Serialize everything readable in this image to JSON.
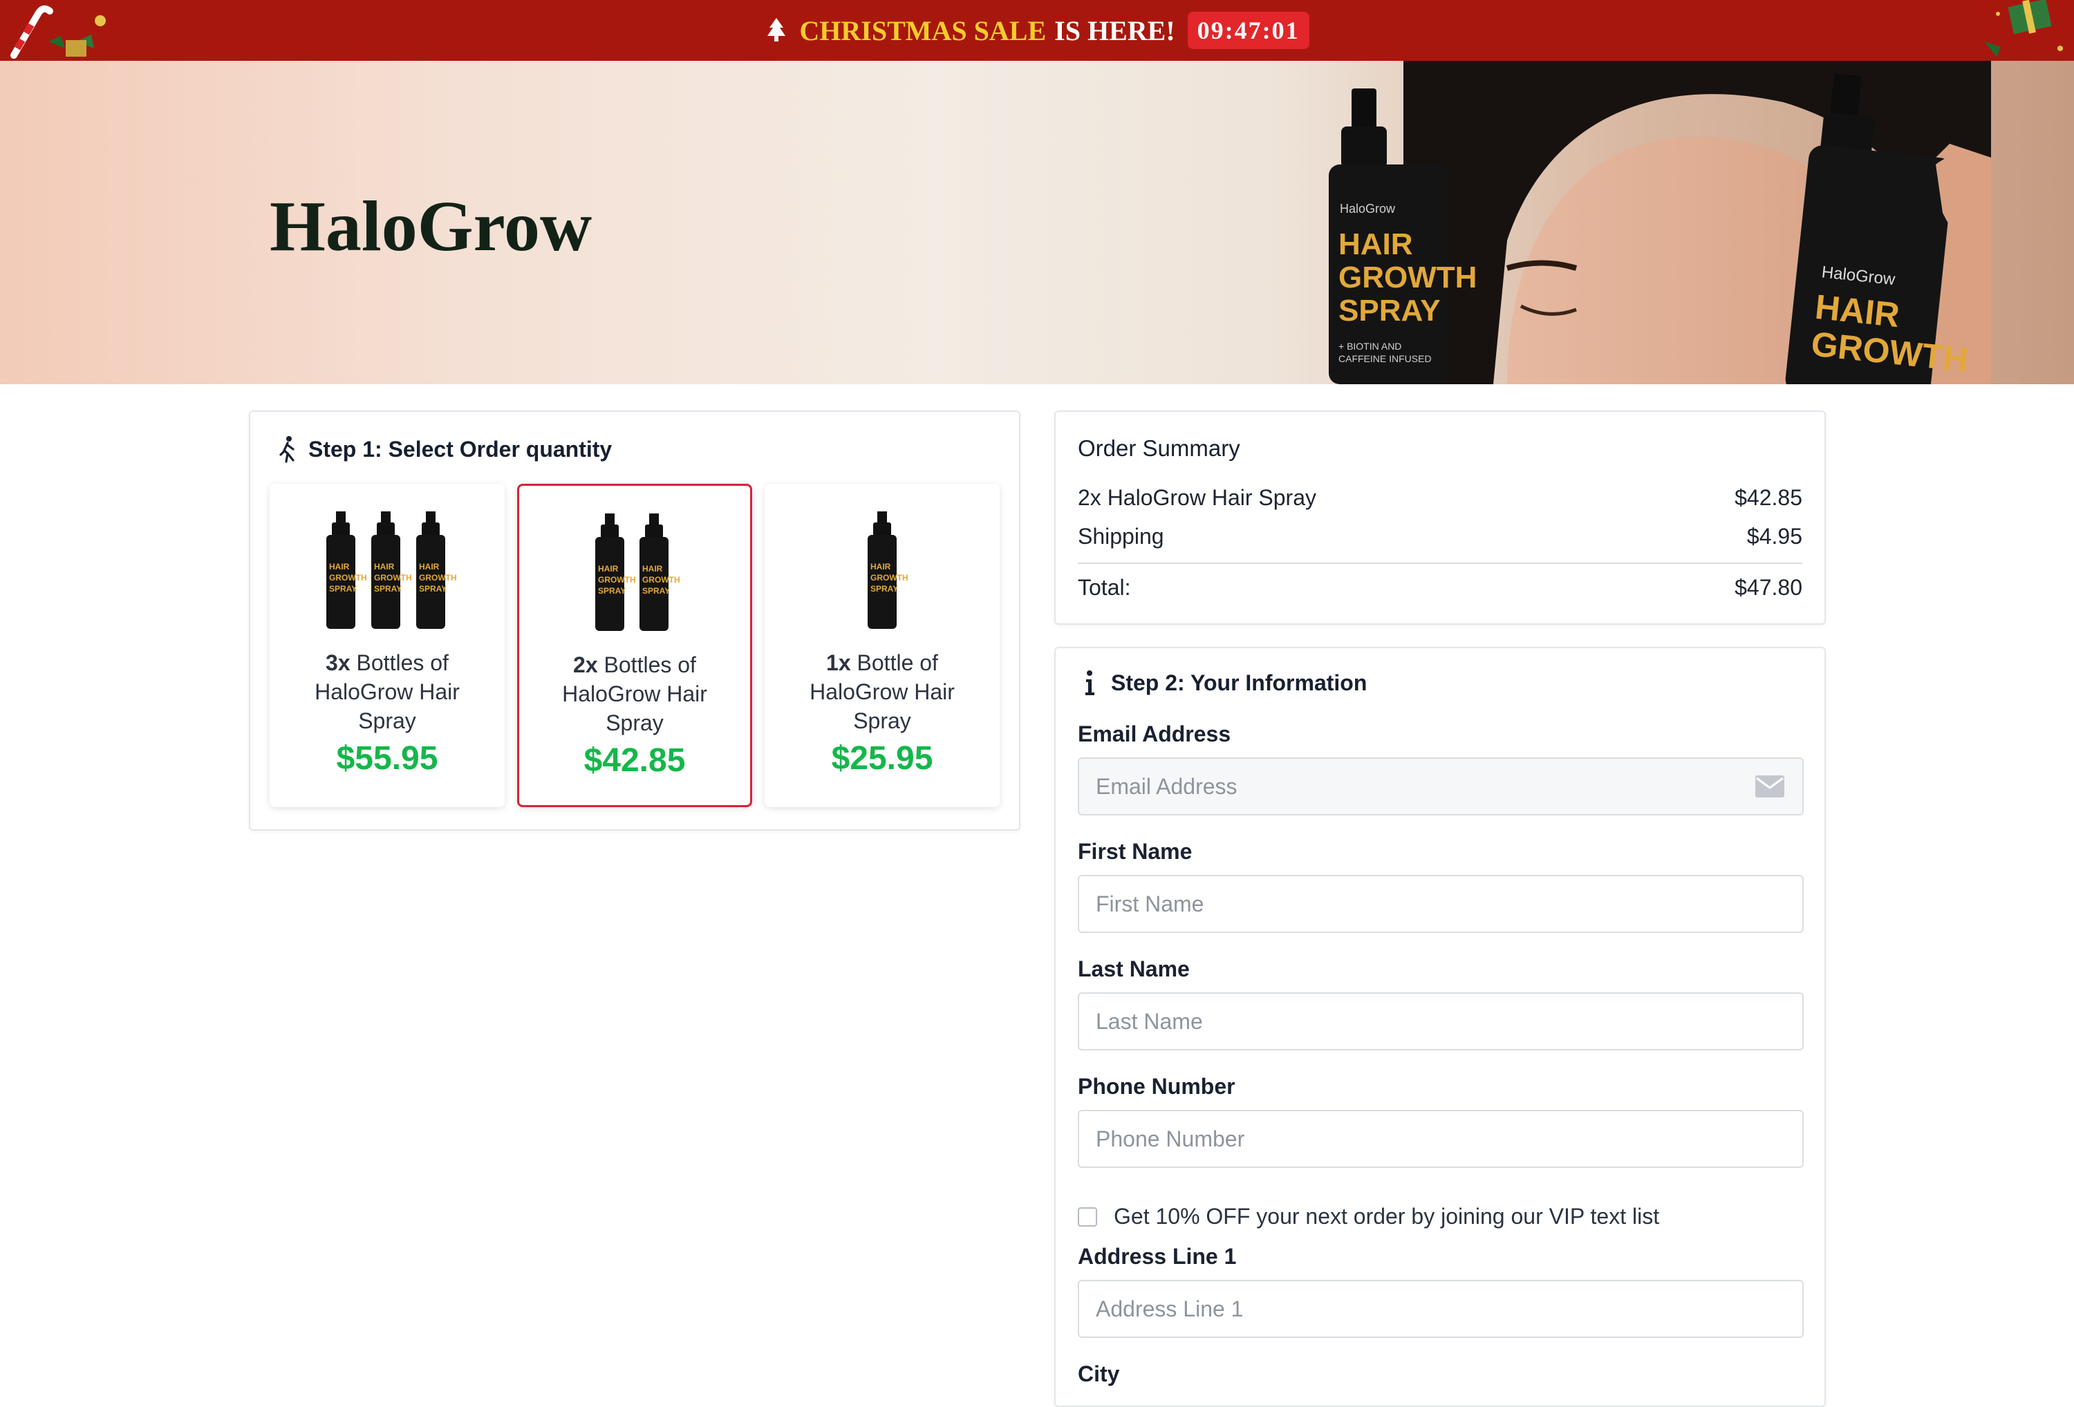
{
  "banner": {
    "highlight": "CHRISTMAS SALE",
    "rest": "IS HERE!",
    "timer": "09:47:01"
  },
  "hero": {
    "brand": "HaloGrow",
    "bottle_brand": "HaloGrow",
    "bottle_lines": [
      "HAIR",
      "GROWTH",
      "SPRAY"
    ],
    "bottle_sub": [
      "+ BIOTIN AND",
      "CAFFEINE INFUSED"
    ]
  },
  "step1": {
    "title": "Step 1: Select Order quantity",
    "options": [
      {
        "qty": "3x",
        "text": "Bottles of HaloGrow Hair Spray",
        "price": "$55.95",
        "selected": false
      },
      {
        "qty": "2x",
        "text": "Bottles of HaloGrow Hair Spray",
        "price": "$42.85",
        "selected": true
      },
      {
        "qty": "1x",
        "text": "Bottle of HaloGrow Hair Spray",
        "price": "$25.95",
        "selected": false
      }
    ]
  },
  "summary": {
    "title": "Order Summary",
    "item_label": "2x HaloGrow Hair Spray",
    "item_price": "$42.85",
    "shipping_label": "Shipping",
    "shipping_price": "$4.95",
    "total_label": "Total:",
    "total_price": "$47.80"
  },
  "step2": {
    "title": "Step 2: Your Information",
    "email_label": "Email Address",
    "email_placeholder": "Email Address",
    "first_label": "First Name",
    "first_placeholder": "First Name",
    "last_label": "Last Name",
    "last_placeholder": "Last Name",
    "phone_label": "Phone Number",
    "phone_placeholder": "Phone Number",
    "vip_text": "Get 10% OFF your next order by joining our VIP text list",
    "address1_label": "Address Line 1",
    "address1_placeholder": "Address Line 1",
    "city_label": "City"
  },
  "colors": {
    "banner_bg": "#a8170e",
    "sale_gold": "#f6cd2c",
    "timer_red": "#e2262a",
    "price_green": "#14b74a",
    "selected_border": "#d6243a"
  },
  "icons": [
    "christmas-tree-icon",
    "walking-person-icon",
    "info-icon",
    "envelope-icon"
  ]
}
